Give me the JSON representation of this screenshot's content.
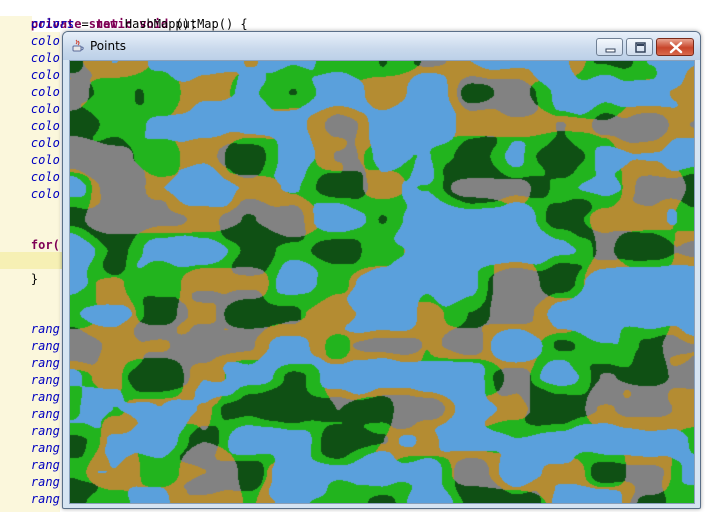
{
  "editor": {
    "lines": [
      "private static void putMap() {",
      "    colors = new HashMap();",
      "    colo",
      "    colo",
      "    colo",
      "    colo",
      "    colo",
      "    colo",
      "    colo",
      "    colo",
      "    colo",
      "    colo",
      "",
      "    for(",
      "",
      "    }",
      "",
      "",
      "    rang",
      "    rang",
      "    rang",
      "    rang",
      "    rang",
      "    rang",
      "    rang",
      "    rang",
      "    rang",
      "    rang",
      "    rang"
    ]
  },
  "window": {
    "title": "Points",
    "icon": "java-cup-icon",
    "controls": [
      "minimize-icon",
      "maximize-icon",
      "close-icon"
    ]
  },
  "map_colors": {
    "water": "#5aa0dc",
    "grass": "#22b41e",
    "sand": "#b48c32",
    "forest": "#0f5014",
    "rock": "#828282"
  }
}
